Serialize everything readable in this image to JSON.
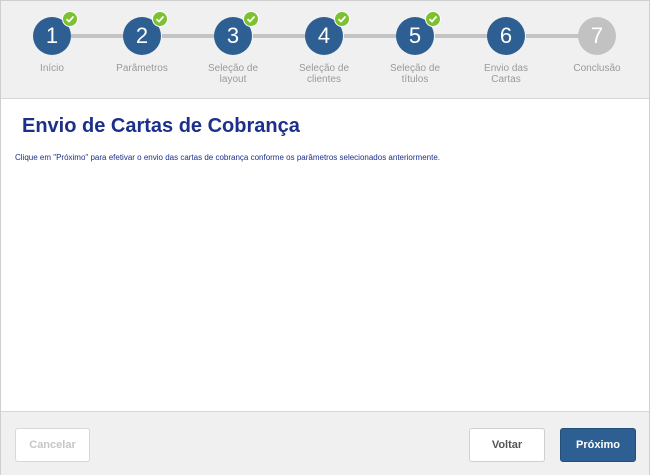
{
  "stepper": {
    "steps": [
      {
        "number": "1",
        "label_lines": [
          "Início",
          ""
        ],
        "status": "done"
      },
      {
        "number": "2",
        "label_lines": [
          "Parâmetros",
          ""
        ],
        "status": "done"
      },
      {
        "number": "3",
        "label_lines": [
          "Seleção de",
          "layout"
        ],
        "status": "done"
      },
      {
        "number": "4",
        "label_lines": [
          "Seleção de",
          "clientes"
        ],
        "status": "done"
      },
      {
        "number": "5",
        "label_lines": [
          "Seleção de",
          "títulos"
        ],
        "status": "done"
      },
      {
        "number": "6",
        "label_lines": [
          "Envio das",
          "Cartas"
        ],
        "status": "current"
      },
      {
        "number": "7",
        "label_lines": [
          "Conclusão",
          ""
        ],
        "status": "pending"
      }
    ],
    "colors": {
      "active": "#2d5f93",
      "pending": "#c2c2c2",
      "check": "#7cc12f"
    }
  },
  "main": {
    "title": "Envio de Cartas de Cobrança",
    "instruction": "Clique em \"Próximo\" para efetivar o envio das cartas de cobrança conforme os parâmetros selecionados anteriormente."
  },
  "footer": {
    "cancel_label": "Cancelar",
    "back_label": "Voltar",
    "next_label": "Próximo"
  }
}
